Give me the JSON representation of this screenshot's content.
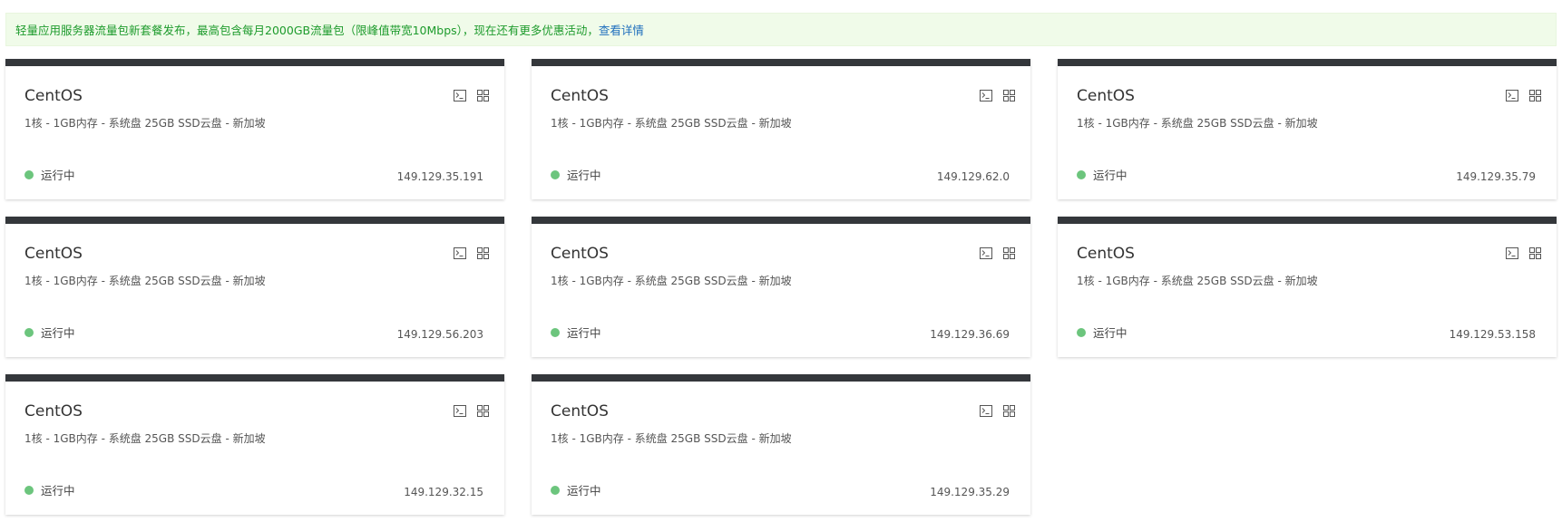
{
  "notice": {
    "text": "轻量应用服务器流量包新套餐发布，最高包含每月2000GB流量包（限峰值带宽10Mbps），现在还有更多优惠活动，",
    "link_label": "查看详情"
  },
  "instances": [
    {
      "title": "CentOS",
      "spec": "1核 - 1GB内存 - 系统盘 25GB SSD云盘 - 新加坡",
      "status": "运行中",
      "ip": "149.129.35.191"
    },
    {
      "title": "CentOS",
      "spec": "1核 - 1GB内存 - 系统盘 25GB SSD云盘 - 新加坡",
      "status": "运行中",
      "ip": "149.129.62.0"
    },
    {
      "title": "CentOS",
      "spec": "1核 - 1GB内存 - 系统盘 25GB SSD云盘 - 新加坡",
      "status": "运行中",
      "ip": "149.129.35.79"
    },
    {
      "title": "CentOS",
      "spec": "1核 - 1GB内存 - 系统盘 25GB SSD云盘 - 新加坡",
      "status": "运行中",
      "ip": "149.129.56.203"
    },
    {
      "title": "CentOS",
      "spec": "1核 - 1GB内存 - 系统盘 25GB SSD云盘 - 新加坡",
      "status": "运行中",
      "ip": "149.129.36.69"
    },
    {
      "title": "CentOS",
      "spec": "1核 - 1GB内存 - 系统盘 25GB SSD云盘 - 新加坡",
      "status": "运行中",
      "ip": "149.129.53.158"
    },
    {
      "title": "CentOS",
      "spec": "1核 - 1GB内存 - 系统盘 25GB SSD云盘 - 新加坡",
      "status": "运行中",
      "ip": "149.129.32.15"
    },
    {
      "title": "CentOS",
      "spec": "1核 - 1GB内存 - 系统盘 25GB SSD云盘 - 新加坡",
      "status": "运行中",
      "ip": "149.129.35.29"
    }
  ],
  "icons": {
    "terminal": "terminal-icon",
    "apps": "apps-grid-icon"
  },
  "colors": {
    "card_top_bar": "#34373b",
    "status_running": "#6cc57d",
    "notice_bg": "#f0fbe9",
    "notice_text": "#1d9b2c",
    "link": "#1f6fbd"
  }
}
